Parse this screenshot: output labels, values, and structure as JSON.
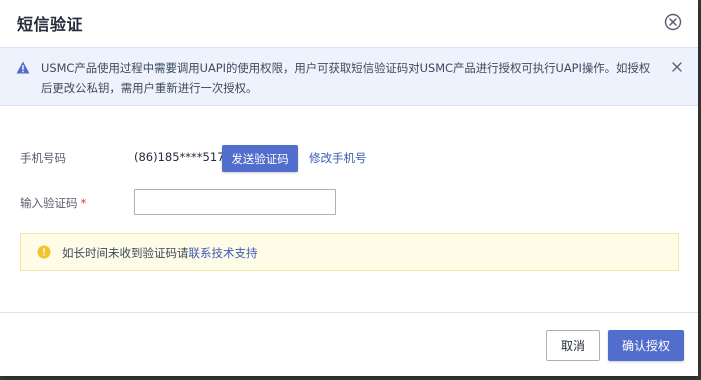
{
  "dialog": {
    "title": "短信验证",
    "close_icon": "close-circle-icon"
  },
  "alert": {
    "icon": "warning-triangle-icon",
    "text": "USMC产品使用过程中需要调用UAPI的使用权限，用户可获取短信验证码对USMC产品进行授权可执行UAPI操作。如授权后更改公私钥，需用户重新进行一次授权。",
    "close_icon": "close-icon"
  },
  "form": {
    "phone_label": "手机号码",
    "phone_value": "(86)185****5176",
    "send_code_button": "发送验证码",
    "modify_phone_link": "修改手机号",
    "code_label": "输入验证码",
    "code_required_mark": "*",
    "code_value": ""
  },
  "notice": {
    "icon": "info-circle-icon",
    "text": "如长时间未收到验证码请",
    "link": "联系技术支持"
  },
  "footer": {
    "cancel_label": "取消",
    "confirm_label": "确认授权"
  },
  "colors": {
    "primary": "#526ecc",
    "alert_bg": "#edf2fd",
    "alert_icon": "#526ecc",
    "notice_bg": "#fefbe6",
    "notice_icon": "#f2c530",
    "required": "#e6343f",
    "link": "#3c5ab8"
  }
}
